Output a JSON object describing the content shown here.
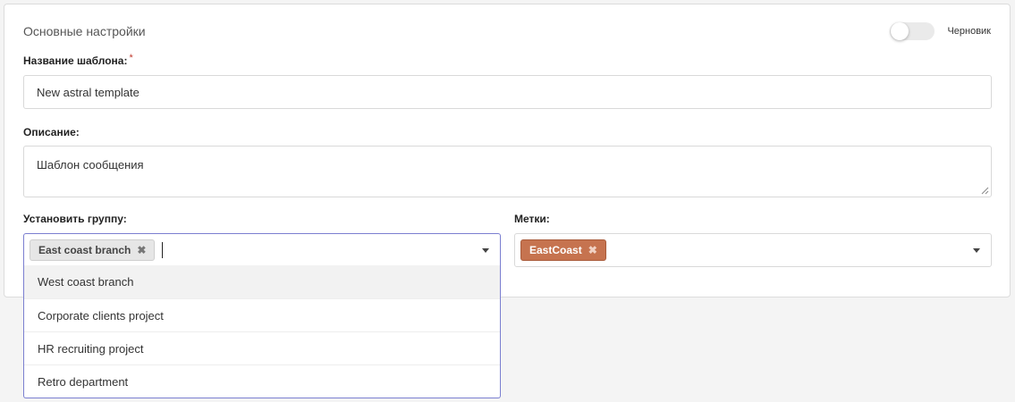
{
  "section": {
    "title": "Основные настройки",
    "draft_label": "Черновик"
  },
  "template_name": {
    "label": "Название шаблона:",
    "required_mark": "*",
    "value": "New astral template"
  },
  "description": {
    "label": "Описание:",
    "value": "Шаблон сообщения"
  },
  "group": {
    "label": "Установить группу:",
    "selected": [
      "East coast branch"
    ],
    "options": [
      "West coast branch",
      "Corporate clients project",
      "HR recruiting project",
      "Retro department"
    ]
  },
  "tags": {
    "label": "Метки:",
    "selected": [
      "EastCoast"
    ]
  },
  "colors": {
    "accent_border": "#7b7fd0",
    "tag_chip": "#c6734f",
    "required": "#c0392b"
  },
  "icons": {
    "chip_remove": "✖",
    "dropdown": "caret-down-icon"
  }
}
